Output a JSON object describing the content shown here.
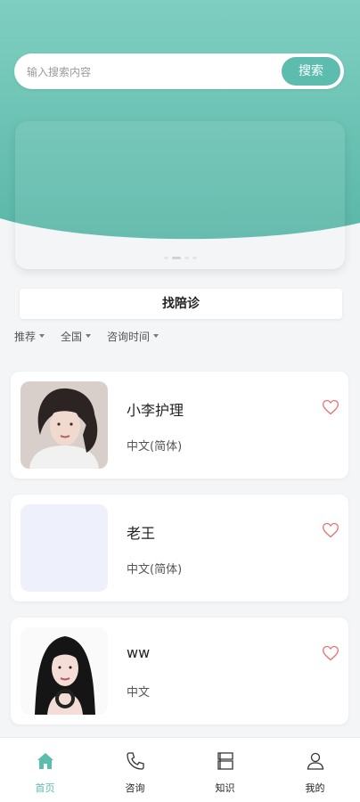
{
  "search": {
    "placeholder": "输入搜索内容",
    "button_label": "搜索"
  },
  "banner": {
    "slide_count": 4,
    "active_index": 1
  },
  "companion_button_label": "找陪诊",
  "filters": [
    {
      "label": "推荐"
    },
    {
      "label": "全国"
    },
    {
      "label": "咨询时间"
    }
  ],
  "cards": [
    {
      "name": "小李护理",
      "language": "中文(简体)",
      "avatar": "woman-portrait-photo",
      "favorite_icon": "heart-outline-icon"
    },
    {
      "name": "老王",
      "language": "中文(简体)",
      "avatar": "blank-placeholder",
      "favorite_icon": "heart-outline-icon"
    },
    {
      "name": "ww",
      "language": "中文",
      "avatar": "woman-portrait-photo",
      "favorite_icon": "heart-outline-icon"
    }
  ],
  "tabbar": [
    {
      "label": "首页",
      "icon": "home-icon",
      "active": true
    },
    {
      "label": "咨询",
      "icon": "phone-icon",
      "active": false
    },
    {
      "label": "知识",
      "icon": "book-icon",
      "active": false
    },
    {
      "label": "我的",
      "icon": "user-icon",
      "active": false
    }
  ],
  "colors": {
    "accent": "#5cbcae",
    "hero_top": "#7fcfc1",
    "hero_bottom": "#5ab7a8",
    "heart": "#e57373",
    "placeholder_avatar": "#eef1fc"
  }
}
